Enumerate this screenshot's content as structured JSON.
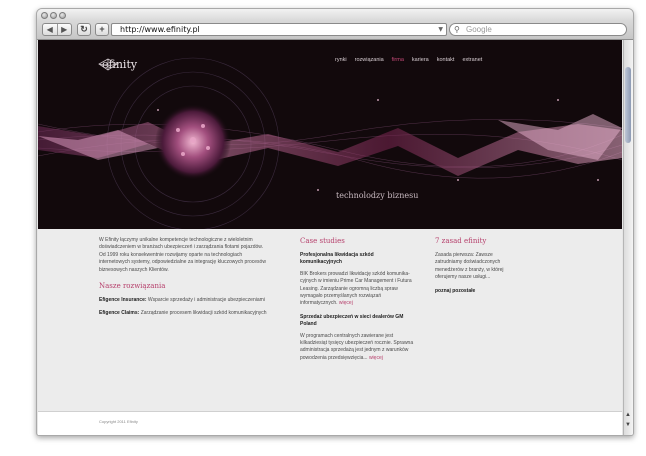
{
  "browser": {
    "url": "http://www.efinity.pl",
    "search_placeholder": "Google",
    "back_icon": "◀",
    "forward_icon": "▶",
    "reload_icon": "↻",
    "add_icon": "+",
    "search_icon": "🔍"
  },
  "site": {
    "logo_text": "efinity",
    "nav": [
      "rynki",
      "rozwiązania",
      "firma",
      "kariera",
      "kontakt",
      "extranet"
    ],
    "active_nav": "firma",
    "tagline": "technolodzy biznesu",
    "accent_color": "#b6406c"
  },
  "intro": {
    "text": "W Efinity łączymy unikalne kompetencje technologiczne z wieloletnim doświadczeniem w branżach ubezpieczeń i zarządzania flotami pojazdów. Od 1999 roku konsekwentnie rozwijamy oparte na technologiach internetowych systemy, odpowiedzialne za integrację kluczowych procesów biznesowych naszych Klientów."
  },
  "solutions": {
    "heading": "Nasze rozwiązania",
    "items": [
      {
        "label": "Efigence Insurance:",
        "text": "Wsparcie sprzedaży i administracje ubezpieczeniami"
      },
      {
        "label": "Efigence Claims:",
        "text": "Zarządzanie procesem likwidacji szkód komunikacyjnych"
      }
    ]
  },
  "case_studies": {
    "heading": "Case studies",
    "items": [
      {
        "title": "Profesjonalna likwidacja szkód komunikacyjnych",
        "text": "BIK Brokers prowadzi likwidację szkód komunika-cyjnych w imieniu Prime Car Management i Futura Leasing. Zarządzanie ogromną liczbą spraw wymagało przemyślanych rozwiązań informatycznych.",
        "more": "więcej"
      },
      {
        "title": "Sprzedaż ubezpieczeń w sieci dealerów GM Poland",
        "text": "W programach centralnych zawierane jest kilkadziesiąt tysięcy ubezpieczeń rocznie. Sprawna administracja sprzedażą jest jednym z warunków powodzenia przedsięwzięcia...",
        "more": "więcej"
      }
    ]
  },
  "seven_rules": {
    "heading": "7 zasad efinity",
    "text": "Zasada pierwsza: Zawsze zatrudniamy doświadczonych menedżerów z branży, w której oferujemy nasze usługi...",
    "more": "poznaj pozostałe"
  },
  "footer": {
    "copyright": "Copyright 2011 Efinity"
  }
}
